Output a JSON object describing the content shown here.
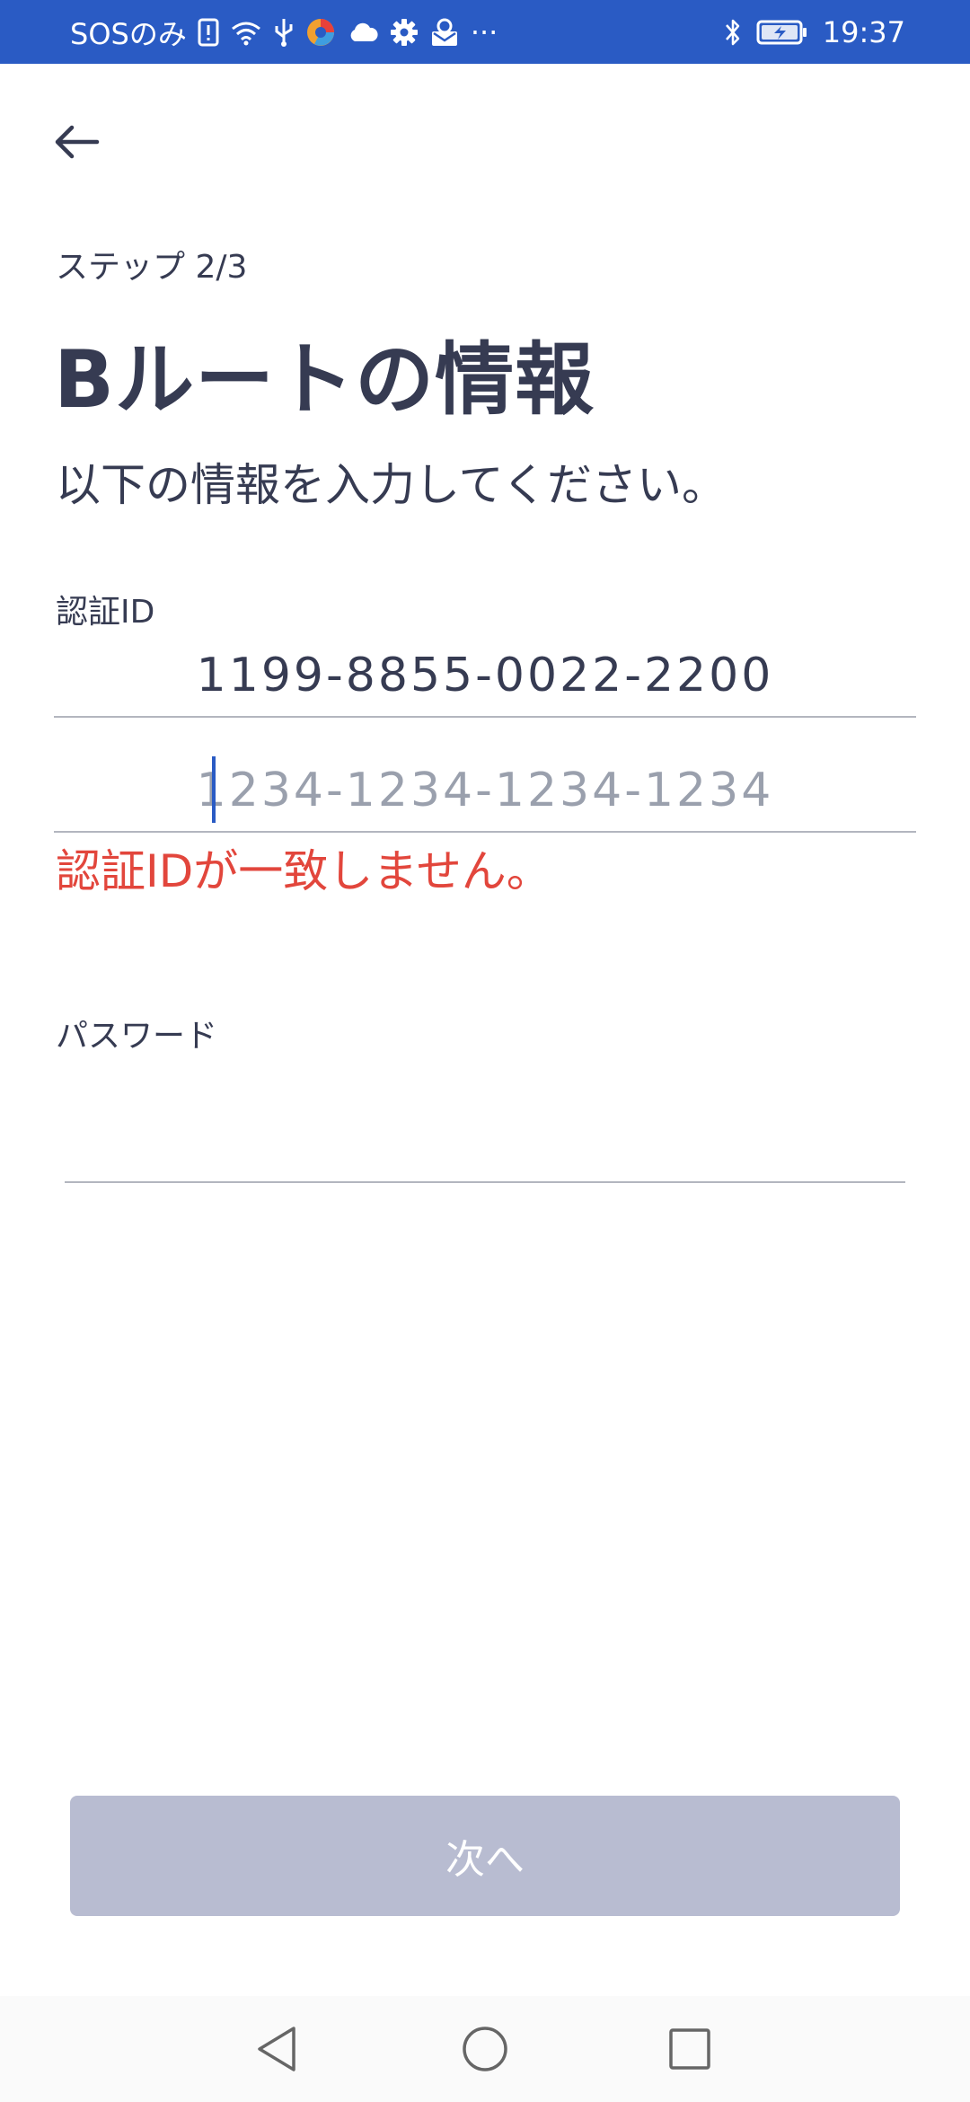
{
  "status_bar": {
    "carrier": "SOSのみ",
    "time": "19:37",
    "more": "···",
    "icons": [
      "sim-alert-icon",
      "wifi-icon",
      "usb-icon",
      "browser-app-icon",
      "cloud-icon",
      "gear-icon",
      "mail-app-icon",
      "bluetooth-icon",
      "battery-charging-icon"
    ]
  },
  "header": {
    "back_icon": "arrow-left-icon",
    "step": "ステップ 2/3",
    "title": "Bルートの情報",
    "subtitle": "以下の情報を入力してください。"
  },
  "form": {
    "auth_id": {
      "label": "認証ID",
      "value": "1199-8855-0022-2200",
      "confirm_value": "",
      "confirm_placeholder": "1234-1234-1234-1234",
      "error": "認証IDが一致しません。"
    },
    "password": {
      "label": "パスワード",
      "value": ""
    }
  },
  "actions": {
    "next_label": "次へ",
    "next_enabled": false
  },
  "nav_bar": {
    "icons": [
      "back-triangle-icon",
      "home-circle-icon",
      "recents-square-icon"
    ]
  },
  "colors": {
    "status_bar": "#2a5bc4",
    "text": "#363b52",
    "error": "#e2463c",
    "button_disabled": "#b8bcd1",
    "caret": "#2a5bc4"
  }
}
